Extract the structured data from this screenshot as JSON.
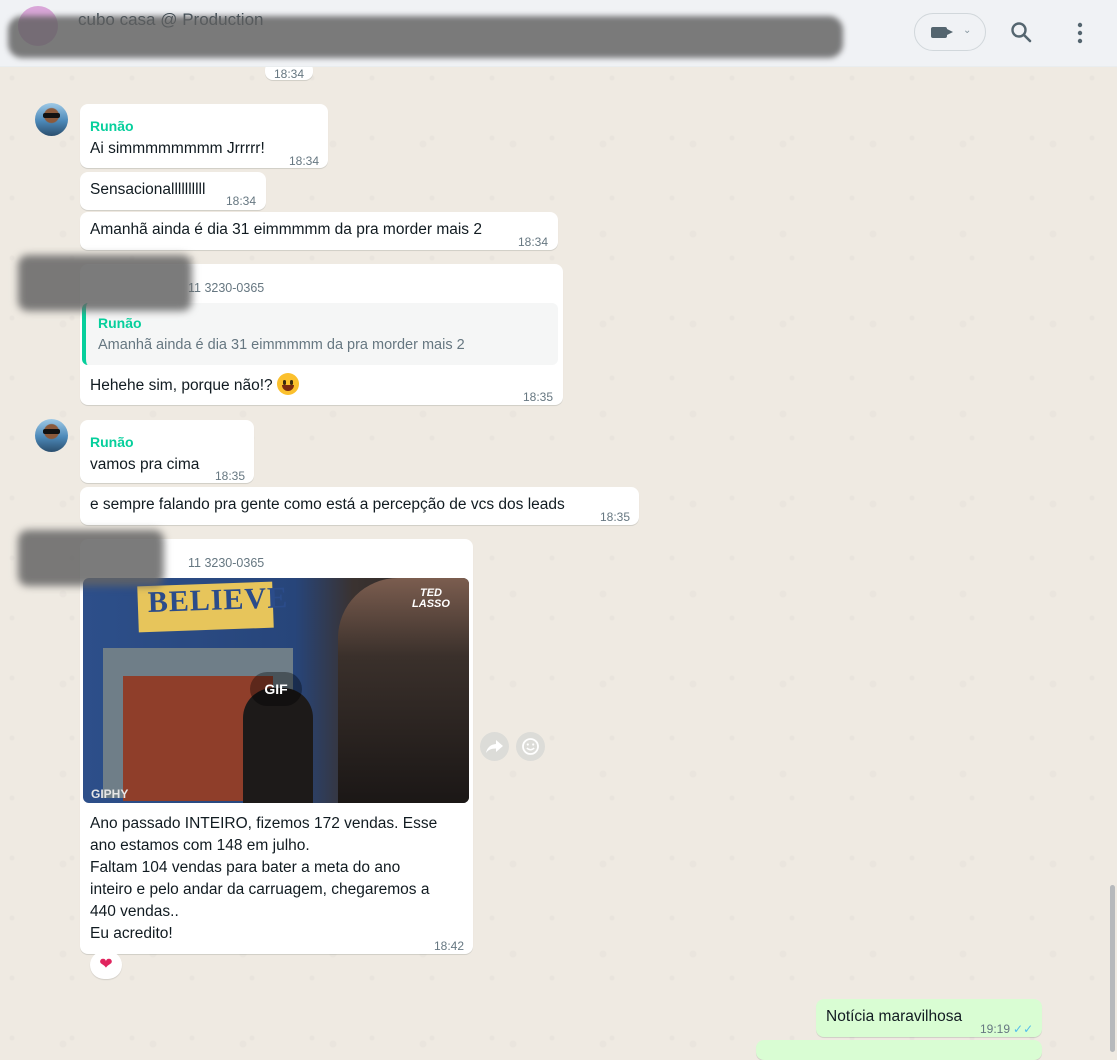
{
  "header": {
    "title": "cubo casa @ Production"
  },
  "messages": {
    "top_time": "18:34",
    "m1_sender": "Runão",
    "m1_text": "Ai simmmmmmmm Jrrrrr!",
    "m1_time": "18:34",
    "m2_text": "Sensacionallllllllll",
    "m2_time": "18:34",
    "m3_text": "Amanhã ainda é dia 31 eimmmmm da pra morder mais 2",
    "m3_time": "18:34",
    "m4_phone": "11 3230-0365",
    "m4_quote_sender": "Runão",
    "m4_quote_text": "Amanhã ainda é dia 31 eimmmmm da pra morder mais 2",
    "m4_text": "Hehehe sim, porque não!?",
    "m4_time": "18:35",
    "m5_sender": "Runão",
    "m5_text": "vamos pra cima",
    "m5_time": "18:35",
    "m6_text": "e sempre falando pra gente como está a percepção de vcs dos leads",
    "m6_time": "18:35",
    "m7_phone": "11 3230-0365",
    "m7_gif_sign": "BELIEVE",
    "m7_gif_badge": "GIF",
    "m7_gif_brand": "GIPHY",
    "m7_gif_show": "TED LASSO",
    "m7_line1": "Ano passado INTEIRO, fizemos 172 vendas. Esse",
    "m7_line2": "ano estamos com 148 em julho.",
    "m7_line3": "Faltam 104 vendas para bater a meta do ano",
    "m7_line4": "inteiro e pelo andar da carruagem, chegaremos a",
    "m7_line5": "440 vendas..",
    "m7_line6": "Eu acredito!",
    "m7_time": "18:42",
    "m7_reaction": "❤",
    "m8_text": "Notícia maravilhosa",
    "m8_time": "19:19"
  },
  "icons": {
    "video": "video-call-icon",
    "search": "search-icon",
    "menu": "menu-icon",
    "forward": "forward-icon",
    "react": "emoji-icon",
    "double_check": "double-check-icon"
  }
}
